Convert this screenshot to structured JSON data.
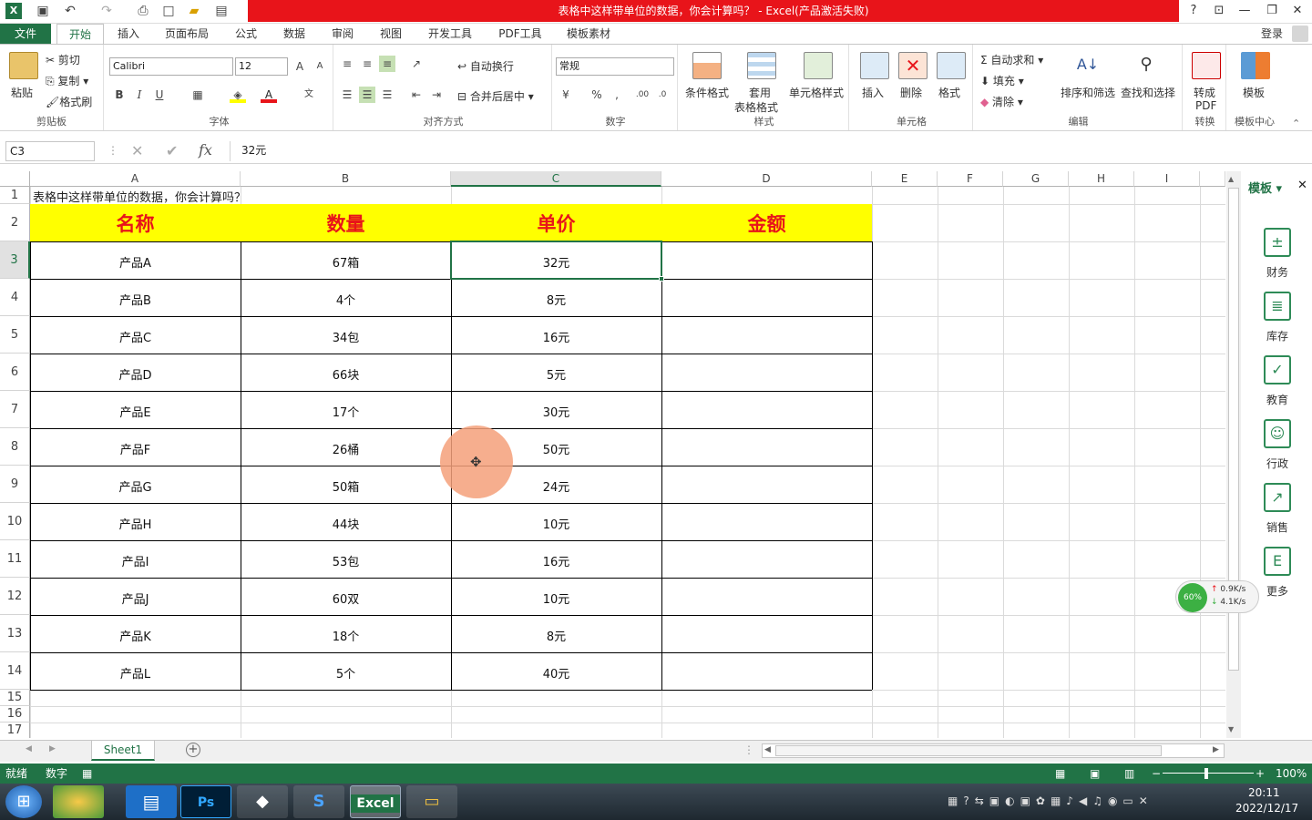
{
  "window": {
    "title": "表格中这样带单位的数据，你会计算吗？ - Excel(产品激活失败)",
    "help": "?",
    "login": "登录"
  },
  "tabs": [
    "文件",
    "开始",
    "插入",
    "页面布局",
    "公式",
    "数据",
    "审阅",
    "视图",
    "开发工具",
    "PDF工具",
    "模板素材"
  ],
  "ribbon": {
    "clipboard": {
      "paste": "粘贴",
      "cut": "剪切",
      "copy": "复制",
      "format_painter": "格式刷",
      "label": "剪贴板"
    },
    "font": {
      "name": "Calibri",
      "size": "12",
      "bold": "B",
      "italic": "I",
      "underline": "U",
      "label": "字体",
      "font_color": "#e8141a",
      "fill_color": "#ffff00"
    },
    "alignment": {
      "wrap": "自动换行",
      "merge": "合并后居中",
      "label": "对齐方式"
    },
    "number": {
      "format": "常规",
      "label": "数字"
    },
    "styles": {
      "conditional": "条件格式",
      "table1": "套用",
      "table2": "表格格式",
      "cell_styles": "单元格样式",
      "label": "样式"
    },
    "cells": {
      "insert": "插入",
      "delete": "删除",
      "format": "格式",
      "label": "单元格"
    },
    "editing": {
      "autosum": "自动求和",
      "fill": "填充",
      "clear": "清除",
      "sort": "排序和筛选",
      "find": "查找和选择",
      "label": "编辑"
    },
    "convert": {
      "pdf1": "转成",
      "pdf2": "PDF",
      "label": "转换"
    },
    "templates": {
      "btn": "模板",
      "label": "模板中心"
    }
  },
  "formula_bar": {
    "name_box": "C3",
    "fx": "fx",
    "value": "32元"
  },
  "columns": [
    "A",
    "B",
    "C",
    "D",
    "E",
    "F",
    "G",
    "H",
    "I"
  ],
  "row_numbers": [
    "1",
    "2",
    "3",
    "4",
    "5",
    "6",
    "7",
    "8",
    "9",
    "10",
    "11",
    "12",
    "13",
    "14",
    "15",
    "16",
    "17"
  ],
  "sheet": {
    "a1": "表格中这样带单位的数据，你会计算吗？",
    "headers": [
      "名称",
      "数量",
      "单价",
      "金额"
    ],
    "rows": [
      [
        "产品A",
        "67箱",
        "32元",
        ""
      ],
      [
        "产品B",
        "4个",
        "8元",
        ""
      ],
      [
        "产品C",
        "34包",
        "16元",
        ""
      ],
      [
        "产品D",
        "66块",
        "5元",
        ""
      ],
      [
        "产品E",
        "17个",
        "30元",
        ""
      ],
      [
        "产品F",
        "26桶",
        "50元",
        ""
      ],
      [
        "产品G",
        "50箱",
        "24元",
        ""
      ],
      [
        "产品H",
        "44块",
        "10元",
        ""
      ],
      [
        "产品I",
        "53包",
        "16元",
        ""
      ],
      [
        "产品J",
        "60双",
        "10元",
        ""
      ],
      [
        "产品K",
        "18个",
        "8元",
        ""
      ],
      [
        "产品L",
        "5个",
        "40元",
        ""
      ]
    ]
  },
  "template_pane": {
    "title": "模板",
    "items": [
      {
        "label": "财务",
        "icon": "finance-icon"
      },
      {
        "label": "库存",
        "icon": "inventory-icon"
      },
      {
        "label": "教育",
        "icon": "education-icon"
      },
      {
        "label": "行政",
        "icon": "admin-icon"
      },
      {
        "label": "销售",
        "icon": "sales-icon"
      },
      {
        "label": "更多",
        "icon": "more-icon"
      }
    ]
  },
  "net_widget": {
    "percent": "60%",
    "up": "0.9K/s",
    "down": "4.1K/s"
  },
  "sheet_tabs": [
    "Sheet1"
  ],
  "status": {
    "ready": "就绪",
    "mode": "数字",
    "zoom": "100%"
  },
  "taskbar": {
    "time": "20:11",
    "date": "2022/12/17",
    "apps": [
      "Ps",
      "Excel"
    ]
  },
  "colors": {
    "excel_green": "#217346",
    "title_red": "#e8141a",
    "header_yellow": "#ffff00",
    "cursor_highlight": "#f4a07a"
  }
}
